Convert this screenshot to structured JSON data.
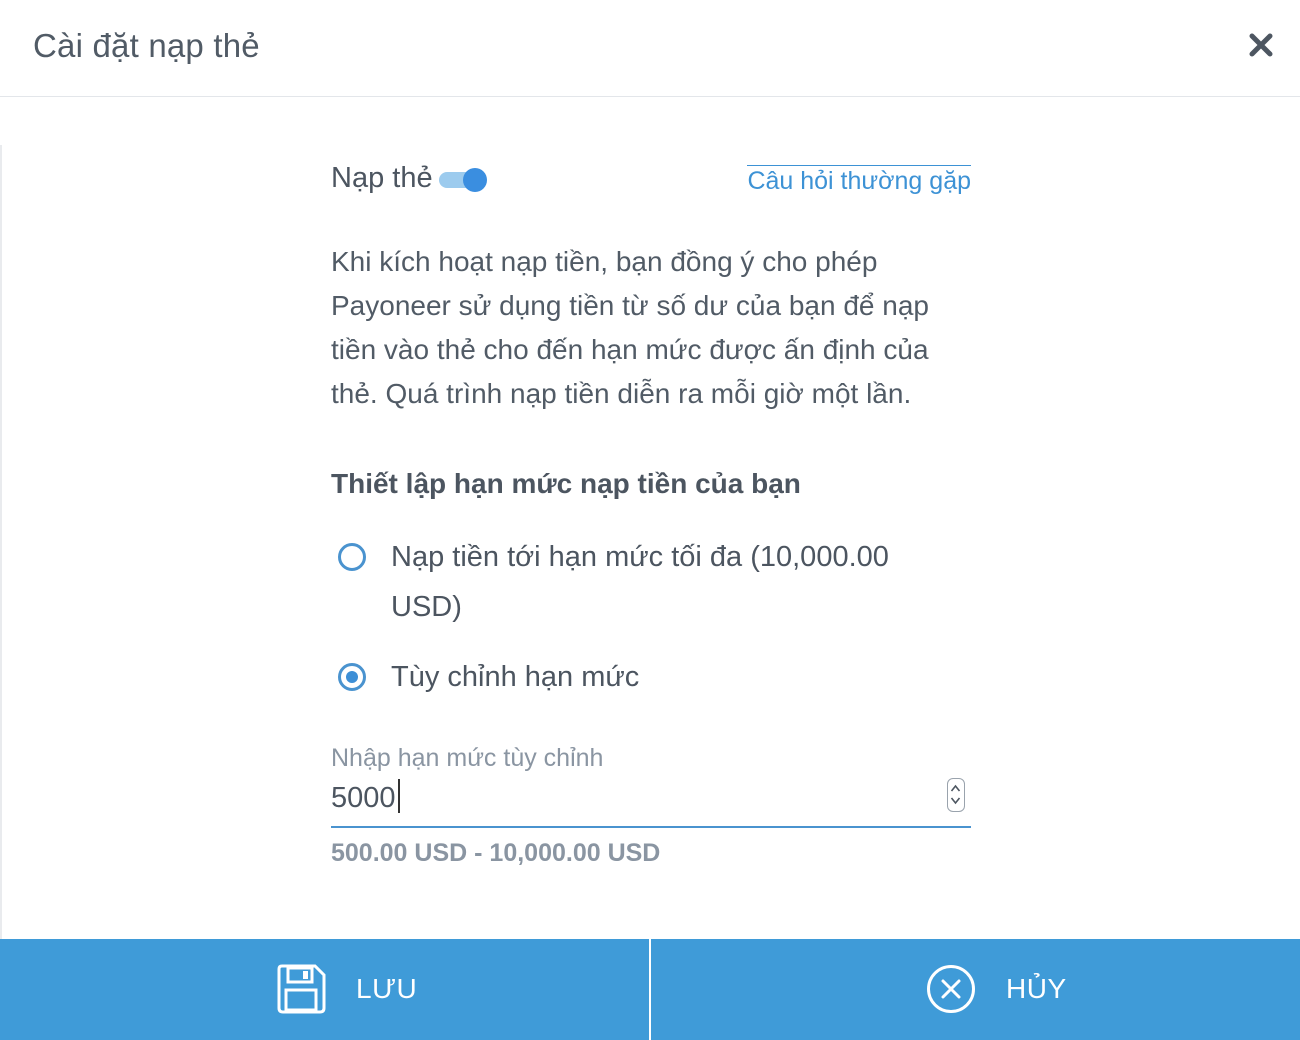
{
  "header": {
    "title": "Cài đặt nạp thẻ",
    "close_icon": "close-icon"
  },
  "toggle": {
    "label": "Nạp thẻ",
    "enabled": true
  },
  "faq_link": "Câu hỏi thường gặp",
  "description": "Khi kích hoạt nạp tiền, bạn đồng ý cho phép Payoneer sử dụng tiền từ số dư của bạn để nạp tiền vào thẻ cho đến hạn mức được ấn định của thẻ. Quá trình nạp tiền diễn ra mỗi giờ một lần.",
  "limit_section": {
    "title": "Thiết lập hạn mức nạp tiền của bạn",
    "options": [
      {
        "label": "Nạp tiền tới hạn mức tối đa (10,000.00 USD)",
        "selected": false
      },
      {
        "label": "Tùy chỉnh hạn mức",
        "selected": true
      }
    ]
  },
  "custom_input": {
    "label": "Nhập hạn mức tùy chỉnh",
    "value": "5000",
    "range_hint": "500.00 USD - 10,000.00 USD"
  },
  "footer": {
    "save_label": "LƯU",
    "save_icon": "floppy-disk-icon",
    "cancel_label": "HỦY",
    "cancel_icon": "circle-x-icon"
  },
  "colors": {
    "accent": "#3f9bd8",
    "link": "#3d92d5",
    "text": "#4c5560",
    "muted": "#8a95a2"
  }
}
